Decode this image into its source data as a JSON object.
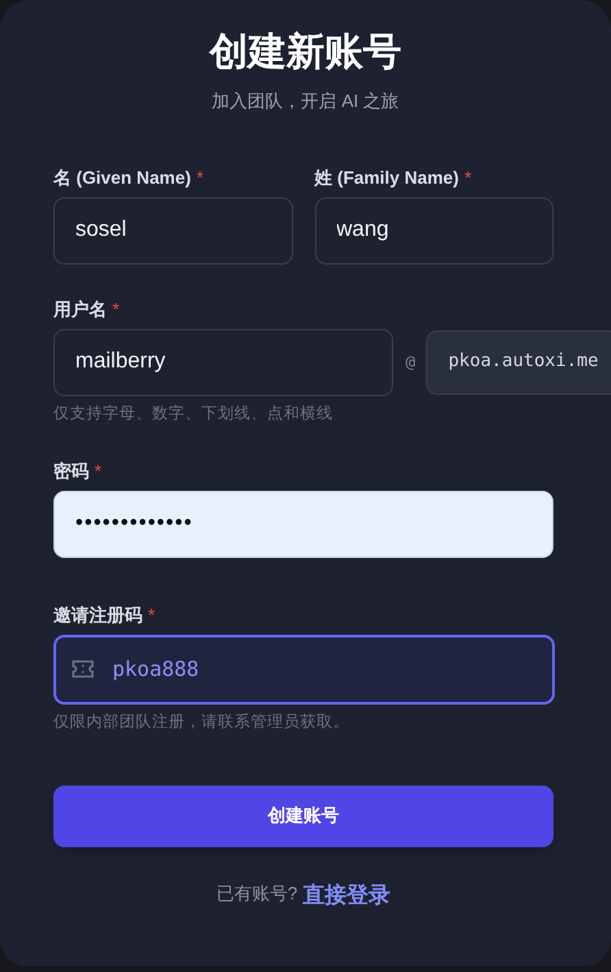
{
  "title": "创建新账号",
  "subtitle": "加入团队，开启 AI 之旅",
  "name_fields": [
    {
      "label": "名 (Given Name)",
      "required_mark": "*",
      "value": "sosel"
    },
    {
      "label": "姓 (Family Name)",
      "required_mark": "*",
      "value": "wang"
    }
  ],
  "username": {
    "label": "用户名",
    "required_mark": "*",
    "value": "mailberry",
    "at": "@",
    "domain": "pkoa.autoxi.me",
    "hint": "仅支持字母、数字、下划线、点和横线"
  },
  "password": {
    "label": "密码",
    "required_mark": "*",
    "value": "•••••••••••••",
    "autofilled": true
  },
  "invite": {
    "label": "邀请注册码",
    "required_mark": "*",
    "value": "pkoa888",
    "focused": true,
    "hint": "仅限内部团队注册，请联系管理员获取。"
  },
  "submit": "创建账号",
  "footer": {
    "text": "已有账号?",
    "link": "直接登录"
  }
}
